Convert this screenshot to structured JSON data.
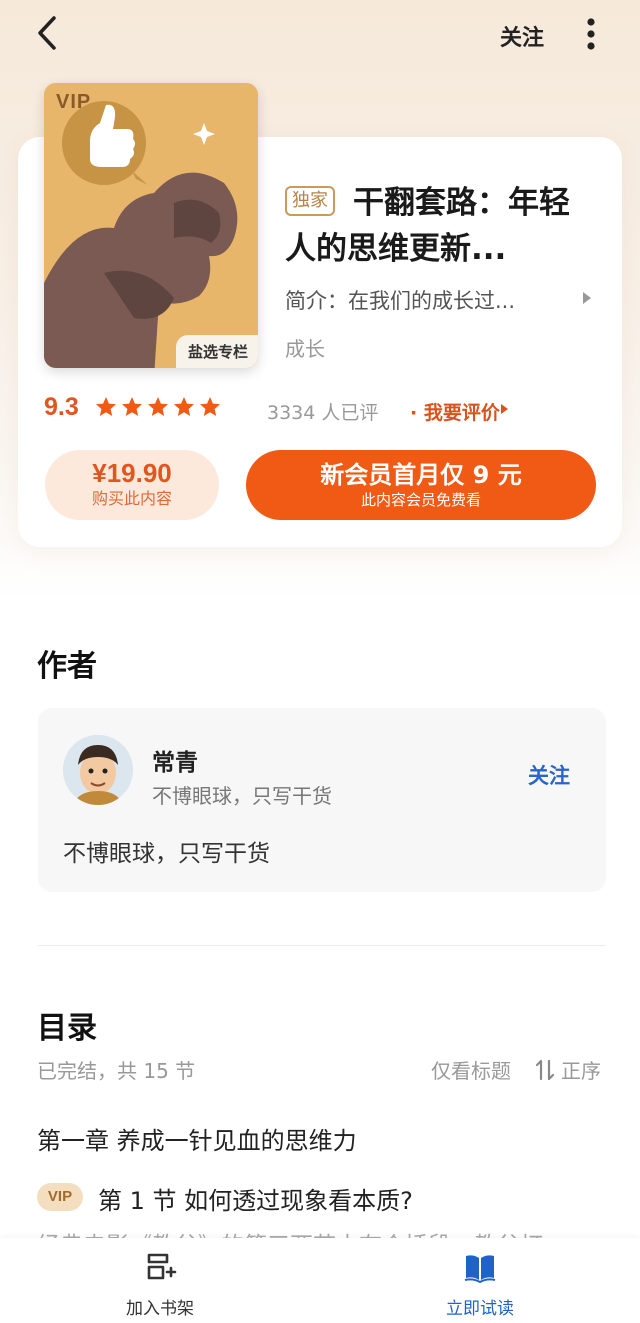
{
  "topbar": {
    "follow_label": "关注"
  },
  "book": {
    "cover_vip": "VIP",
    "cover_tag": "盐选专栏",
    "exclusive_badge": "独家",
    "title": "干翻套路：年轻人的思维更新...",
    "intro": "简介：在我们的成长过...",
    "category": "成长",
    "rating": "9.3",
    "stars": 5,
    "rating_count": "3334 人已评",
    "rate_link": "· 我要评价"
  },
  "buttons": {
    "buy_price": "¥19.90",
    "buy_sub": "购买此内容",
    "member_main": "新会员首月仅 9 元",
    "member_sub": "此内容会员免费看"
  },
  "author_section": {
    "title": "作者",
    "name": "常青",
    "tagline": "不博眼球，只写干货",
    "follow_label": "关注",
    "description": "不博眼球，只写干货"
  },
  "toc": {
    "title": "目录",
    "status": "已完结，共 15 节",
    "only_titles": "仅看标题",
    "order": "正序",
    "chapter": "第一章 养成一针见血的思维力",
    "vip_pill": "VIP",
    "section": "第 1 节 如何透过现象看本质?",
    "excerpt": "经典电影《教父》的第三两节中有个插段，教父打"
  },
  "bottom_bar": {
    "shelf_label": "加入书架",
    "read_label": "立即试读"
  },
  "colors": {
    "accent_orange": "#f05a14",
    "link_blue": "#2a66c9",
    "gold": "#b7834a"
  }
}
